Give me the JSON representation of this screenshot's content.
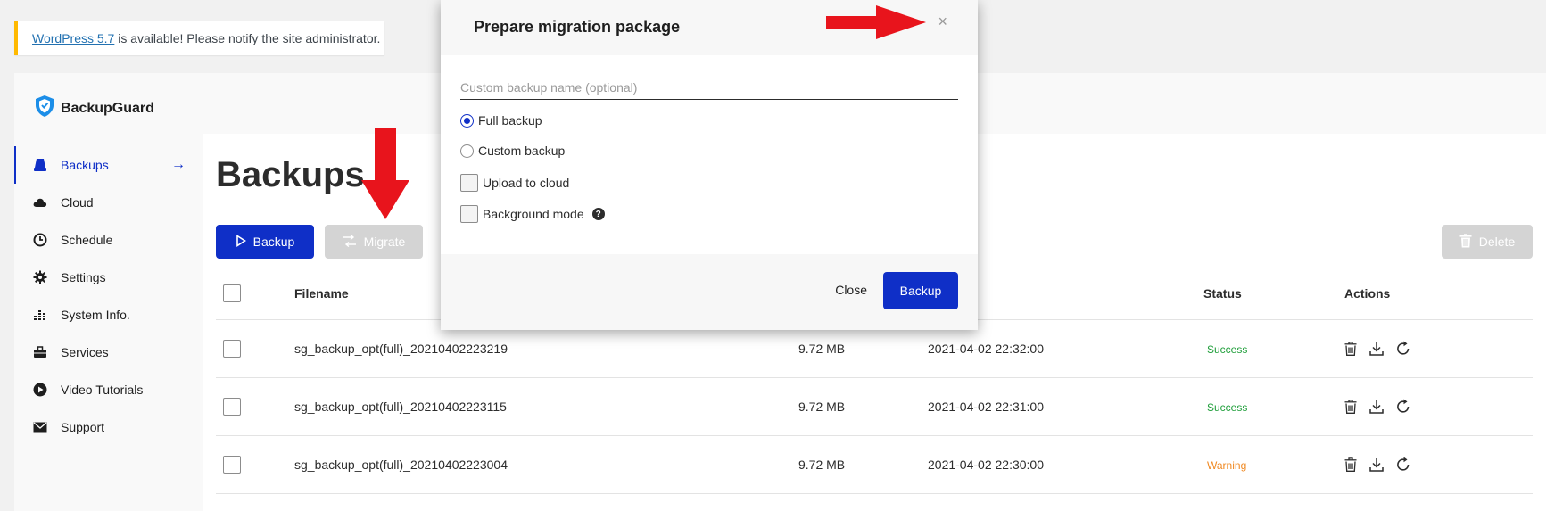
{
  "notice": {
    "link_text": "WordPress 5.7",
    "rest_text": " is available! Please notify the site administrator."
  },
  "brand": {
    "name": "BackupGuard",
    "icon": "shield-logo"
  },
  "sidebar": {
    "items": [
      {
        "label": "Backups",
        "icon": "drive-icon",
        "active": true,
        "arrow": "→"
      },
      {
        "label": "Cloud",
        "icon": "cloud-icon"
      },
      {
        "label": "Schedule",
        "icon": "clock-icon"
      },
      {
        "label": "Settings",
        "icon": "gear-icon"
      },
      {
        "label": "System Info.",
        "icon": "bar-chart-icon"
      },
      {
        "label": "Services",
        "icon": "briefcase-icon"
      },
      {
        "label": "Video Tutorials",
        "icon": "play-circle-icon"
      },
      {
        "label": "Support",
        "icon": "envelope-icon"
      }
    ]
  },
  "main": {
    "title": "Backups",
    "buttons": {
      "backup": "Backup",
      "migrate": "Migrate",
      "delete": "Delete"
    },
    "table": {
      "headers": [
        "Filename",
        "Status",
        "Actions"
      ],
      "rows": [
        {
          "filename": "sg_backup_opt(full)_20210402223219",
          "size": "9.72 MB",
          "date": "2021-04-02 22:32:00",
          "status": "Success"
        },
        {
          "filename": "sg_backup_opt(full)_20210402223115",
          "size": "9.72 MB",
          "date": "2021-04-02 22:31:00",
          "status": "Success"
        },
        {
          "filename": "sg_backup_opt(full)_20210402223004",
          "size": "9.72 MB",
          "date": "2021-04-02 22:30:00",
          "status": "Warning"
        }
      ]
    }
  },
  "modal": {
    "title": "Prepare migration package",
    "close_x": "×",
    "name_placeholder": "Custom backup name (optional)",
    "options": {
      "full": "Full backup",
      "custom": "Custom backup",
      "cloud": "Upload to cloud",
      "background": "Background mode"
    },
    "help": "?",
    "close_label": "Close",
    "backup_label": "Backup"
  },
  "colors": {
    "accent": "#0f2fc7",
    "success": "#1f9e3a",
    "warning": "#f08a24",
    "annotation_arrow": "#e8141c",
    "notice_border": "#ffb900"
  }
}
